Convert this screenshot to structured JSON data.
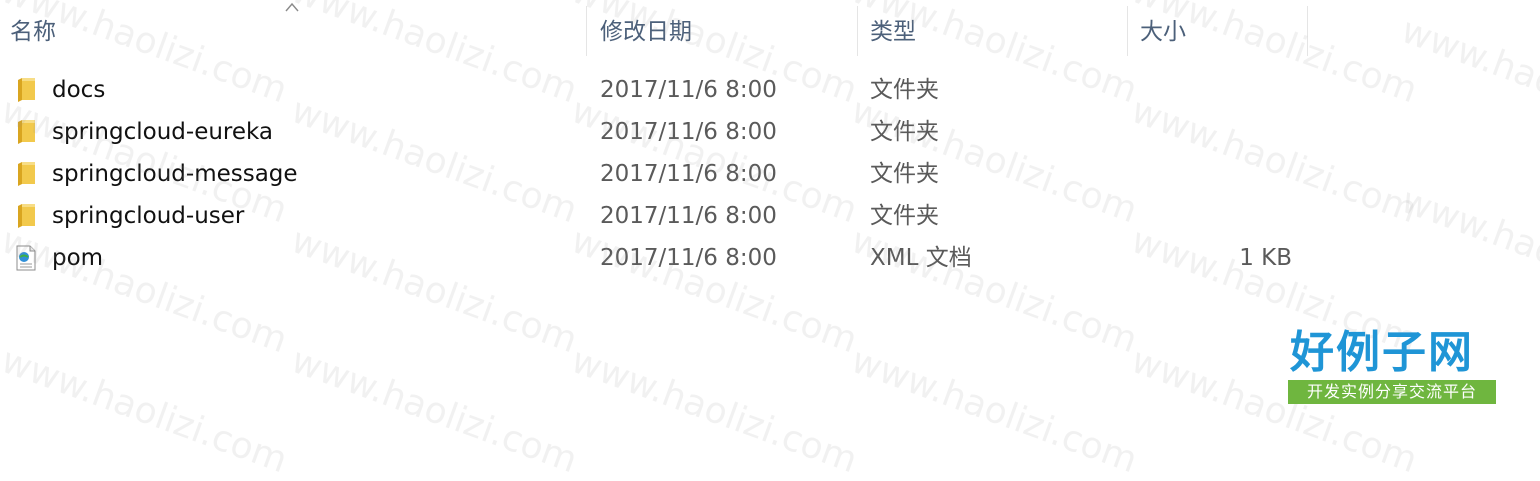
{
  "columns": {
    "name": "名称",
    "date_modified": "修改日期",
    "type": "类型",
    "size": "大小"
  },
  "files": [
    {
      "name": "docs",
      "date_modified": "2017/11/6 8:00",
      "type": "文件夹",
      "size": "",
      "icon": "folder-icon"
    },
    {
      "name": "springcloud-eureka",
      "date_modified": "2017/11/6 8:00",
      "type": "文件夹",
      "size": "",
      "icon": "folder-icon"
    },
    {
      "name": "springcloud-message",
      "date_modified": "2017/11/6 8:00",
      "type": "文件夹",
      "size": "",
      "icon": "folder-icon"
    },
    {
      "name": "springcloud-user",
      "date_modified": "2017/11/6 8:00",
      "type": "文件夹",
      "size": "",
      "icon": "folder-icon"
    },
    {
      "name": "pom",
      "date_modified": "2017/11/6 8:00",
      "type": "XML 文档",
      "size": "1 KB",
      "icon": "xml-document-icon"
    }
  ],
  "watermark": {
    "text": "www.haolizi.com"
  },
  "logo": {
    "title": "好例子网",
    "subtitle": "开发实例分享交流平台"
  },
  "colors": {
    "header_text": "#4c607a",
    "folder": "#f2c94c",
    "logo_blue": "#1f95d6",
    "logo_green": "#6fb63f"
  }
}
